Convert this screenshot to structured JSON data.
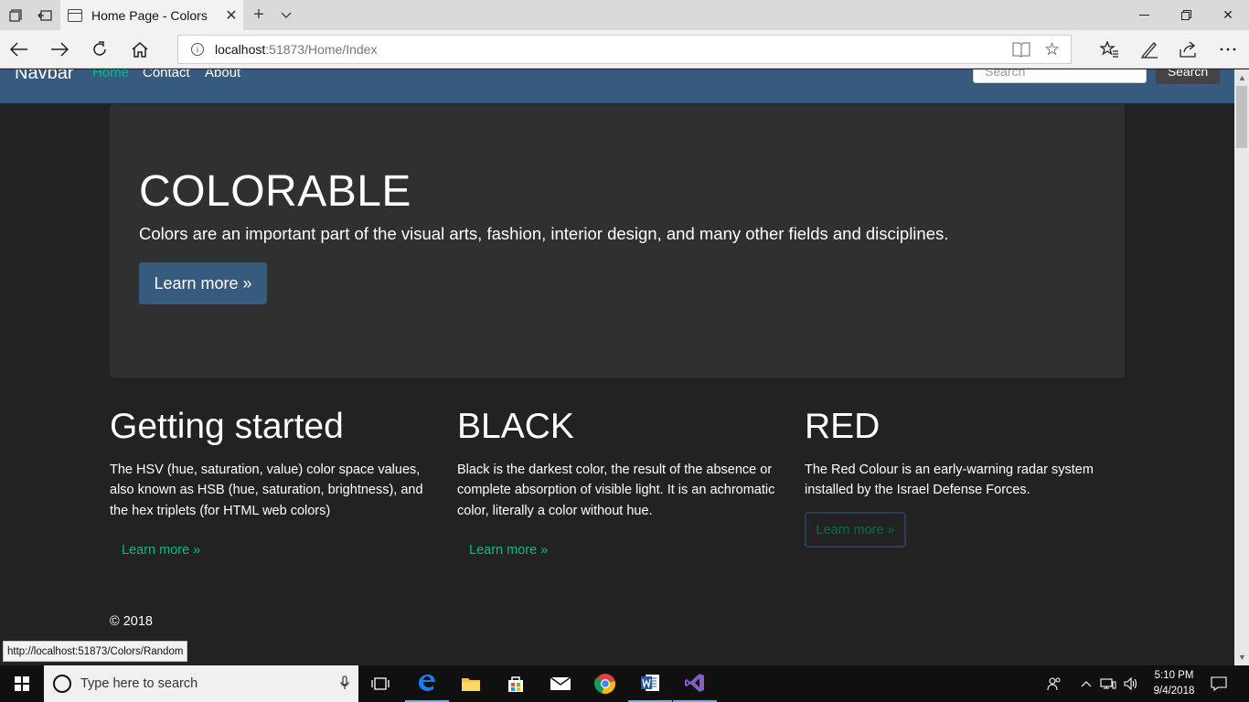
{
  "browser": {
    "tab_title": "Home Page - Colors",
    "url_host": "localhost",
    "url_path": ":51873/Home/Index",
    "status_url": "http://localhost:51873/Colors/Random"
  },
  "navbar": {
    "brand": "Navbar",
    "links": [
      "Home",
      "Contact",
      "About"
    ],
    "search_placeholder": "Search",
    "search_button": "Search"
  },
  "jumbotron": {
    "title": "COLORABLE",
    "text": "Colors are an important part of the visual arts, fashion, interior design, and many other fields and disciplines.",
    "button": "Learn more »"
  },
  "columns": [
    {
      "title": "Getting started",
      "text": "The HSV (hue, saturation, value) color space values, also known as HSB (hue, saturation, brightness), and the hex triplets (for HTML web colors)",
      "link": "Learn more »"
    },
    {
      "title": "BLACK",
      "text": "Black is the darkest color, the result of the absence or complete absorption of visible light. It is an achromatic color, literally a color without hue.",
      "link": "Learn more »"
    },
    {
      "title": "RED",
      "text": "The Red Colour is an early-warning radar system installed by the Israel Defense Forces.",
      "link": "Learn more »"
    }
  ],
  "footer": {
    "copyright": "© 2018"
  },
  "taskbar": {
    "search_placeholder": "Type here to search",
    "time": "5:10 PM",
    "date": "9/4/2018"
  },
  "colors": {
    "navbar_bg": "#375a7f",
    "accent_green": "#00bc8c",
    "page_bg": "#222222",
    "jumbotron_bg": "#303030"
  },
  "icons": {
    "tab_actions": [
      "tab-overview-icon",
      "set-tabs-aside-icon"
    ],
    "nav": [
      "back-icon",
      "forward-icon",
      "refresh-icon",
      "home-icon"
    ],
    "toolbar": [
      "favorites-icon",
      "notes-icon",
      "share-icon",
      "more-icon"
    ],
    "taskbar_apps": [
      "task-view-icon",
      "edge-icon",
      "file-explorer-icon",
      "store-icon",
      "mail-icon",
      "chrome-icon",
      "word-icon",
      "visual-studio-icon"
    ]
  }
}
